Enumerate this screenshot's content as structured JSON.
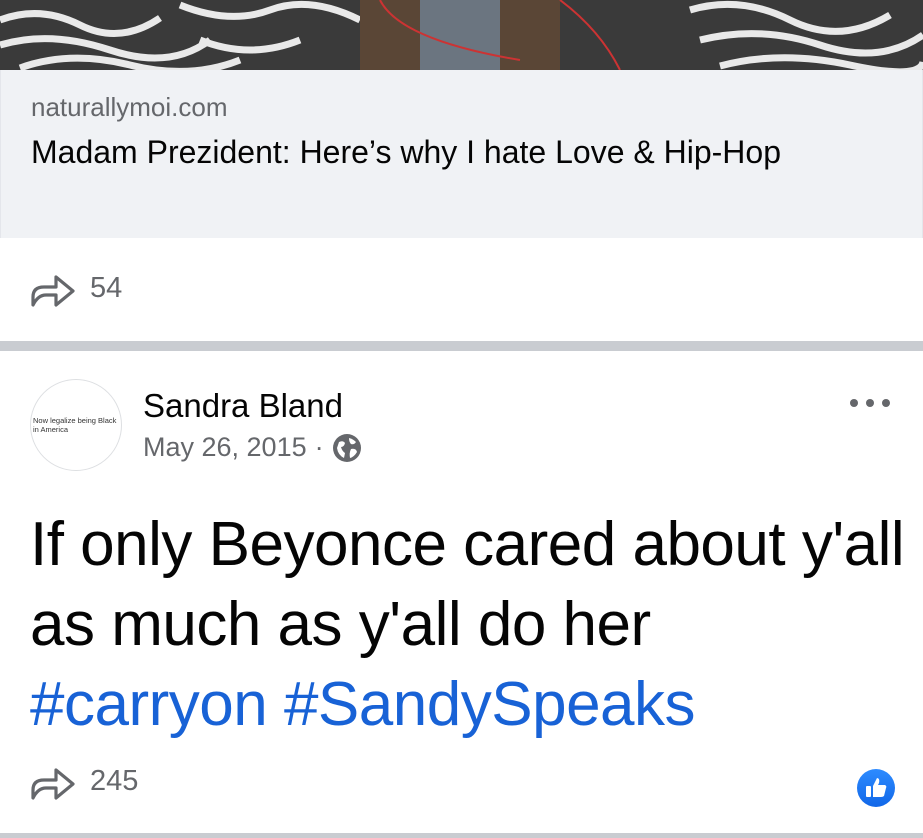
{
  "link_preview": {
    "domain": "naturallymoi.com",
    "title": "Madam Prezident: Here’s why I hate Love & Hip-Hop"
  },
  "first_post": {
    "share_count": "54"
  },
  "post": {
    "author": "Sandra Bland",
    "avatar_text": "Now legalize being Black in America",
    "date": "May 26, 2015",
    "separator": "·",
    "privacy_icon": "globe-icon",
    "text": "If only Beyonce cared about y'all as much as y'all do her",
    "hashtags": [
      "#carryon",
      "#SandySpeaks"
    ],
    "share_count": "245"
  },
  "colors": {
    "hashtag": "#1862d6",
    "secondary_text": "#65676b",
    "like_badge": "#1877f2"
  }
}
